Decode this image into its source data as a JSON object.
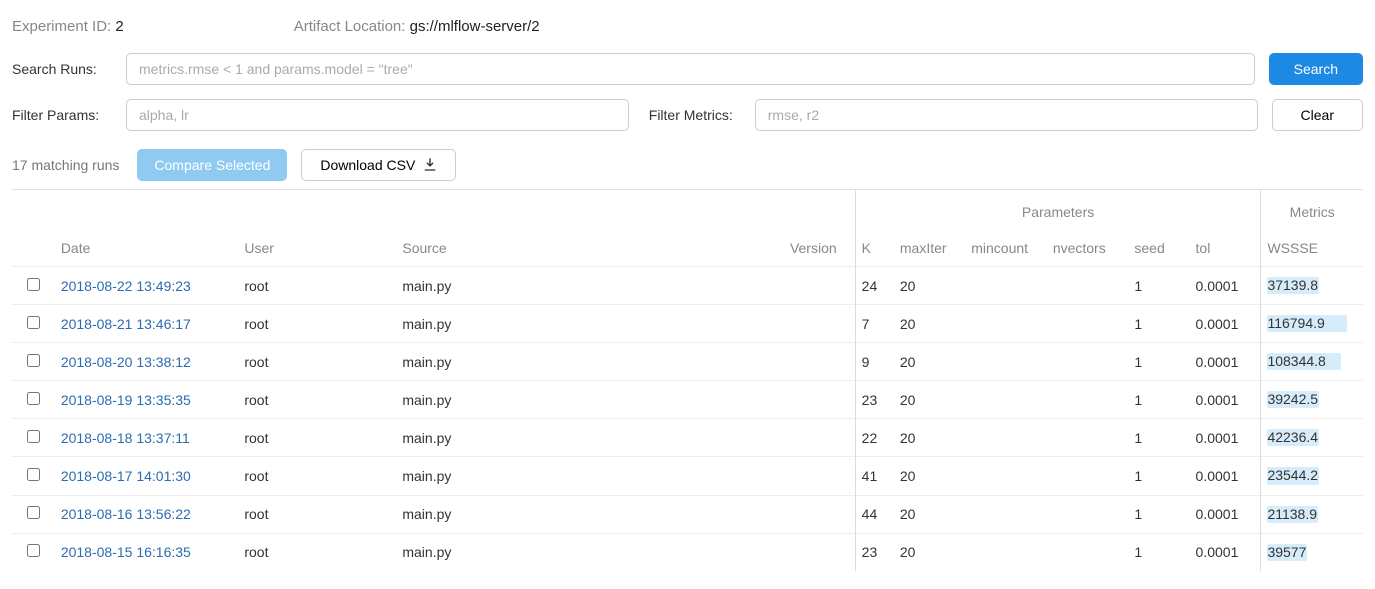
{
  "meta": {
    "exp_label": "Experiment ID:",
    "exp_value": "2",
    "artifact_label": "Artifact Location:",
    "artifact_value": "gs://mlflow-server/2"
  },
  "form": {
    "search_label": "Search Runs:",
    "search_placeholder": "metrics.rmse < 1 and params.model = \"tree\"",
    "search_btn": "Search",
    "filter_params_label": "Filter Params:",
    "filter_params_placeholder": "alpha, lr",
    "filter_metrics_label": "Filter Metrics:",
    "filter_metrics_placeholder": "rmse, r2",
    "clear_btn": "Clear"
  },
  "actions": {
    "result_count": "17 matching runs",
    "compare_btn": "Compare Selected",
    "download_btn": "Download CSV"
  },
  "table": {
    "group_parameters": "Parameters",
    "group_metrics": "Metrics",
    "cols": {
      "date": "Date",
      "user": "User",
      "source": "Source",
      "version": "Version",
      "k": "K",
      "maxiter": "maxIter",
      "mincount": "mincount",
      "nvectors": "nvectors",
      "seed": "seed",
      "tol": "tol",
      "wssse": "WSSSE"
    },
    "wssse_max": 116794.9,
    "rows": [
      {
        "date": "2018-08-22 13:49:23",
        "user": "root",
        "source": "main.py",
        "version": "",
        "k": "24",
        "maxiter": "20",
        "mincount": "",
        "nvectors": "",
        "seed": "1",
        "tol": "0.0001",
        "wssse": "37139.8"
      },
      {
        "date": "2018-08-21 13:46:17",
        "user": "root",
        "source": "main.py",
        "version": "",
        "k": "7",
        "maxiter": "20",
        "mincount": "",
        "nvectors": "",
        "seed": "1",
        "tol": "0.0001",
        "wssse": "116794.9"
      },
      {
        "date": "2018-08-20 13:38:12",
        "user": "root",
        "source": "main.py",
        "version": "",
        "k": "9",
        "maxiter": "20",
        "mincount": "",
        "nvectors": "",
        "seed": "1",
        "tol": "0.0001",
        "wssse": "108344.8"
      },
      {
        "date": "2018-08-19 13:35:35",
        "user": "root",
        "source": "main.py",
        "version": "",
        "k": "23",
        "maxiter": "20",
        "mincount": "",
        "nvectors": "",
        "seed": "1",
        "tol": "0.0001",
        "wssse": "39242.5"
      },
      {
        "date": "2018-08-18 13:37:11",
        "user": "root",
        "source": "main.py",
        "version": "",
        "k": "22",
        "maxiter": "20",
        "mincount": "",
        "nvectors": "",
        "seed": "1",
        "tol": "0.0001",
        "wssse": "42236.4"
      },
      {
        "date": "2018-08-17 14:01:30",
        "user": "root",
        "source": "main.py",
        "version": "",
        "k": "41",
        "maxiter": "20",
        "mincount": "",
        "nvectors": "",
        "seed": "1",
        "tol": "0.0001",
        "wssse": "23544.2"
      },
      {
        "date": "2018-08-16 13:56:22",
        "user": "root",
        "source": "main.py",
        "version": "",
        "k": "44",
        "maxiter": "20",
        "mincount": "",
        "nvectors": "",
        "seed": "1",
        "tol": "0.0001",
        "wssse": "21138.9"
      },
      {
        "date": "2018-08-15 16:16:35",
        "user": "root",
        "source": "main.py",
        "version": "",
        "k": "23",
        "maxiter": "20",
        "mincount": "",
        "nvectors": "",
        "seed": "1",
        "tol": "0.0001",
        "wssse": "39577"
      }
    ]
  }
}
